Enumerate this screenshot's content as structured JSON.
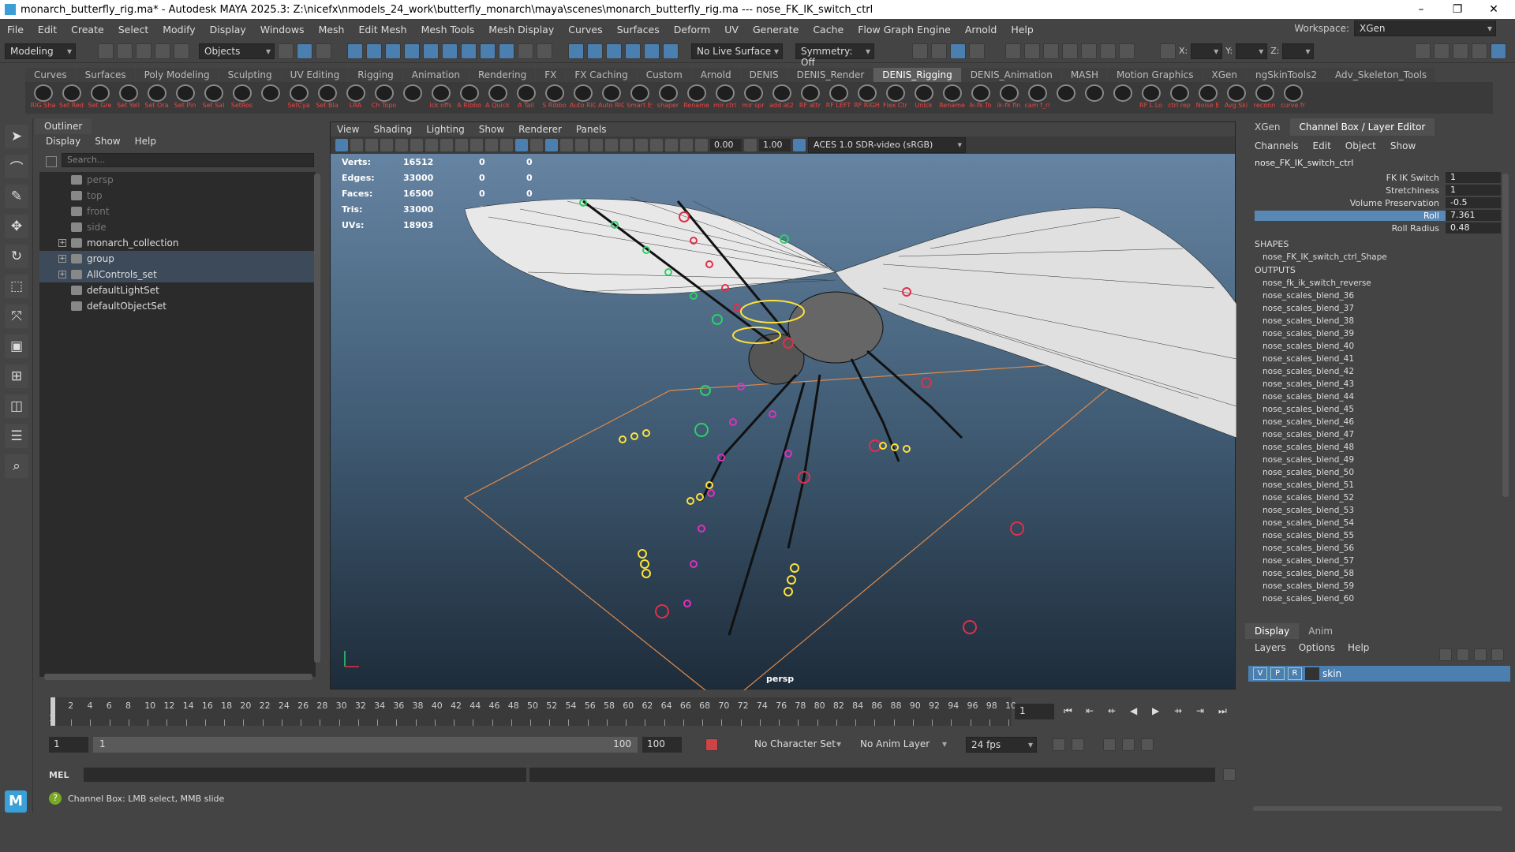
{
  "window": {
    "title": "monarch_butterfly_rig.ma* - Autodesk MAYA 2025.3: Z:\\nicefx\\nmodels_24_work\\butterfly_monarch\\maya\\scenes\\monarch_butterfly_rig.ma  ---  nose_FK_IK_switch_ctrl",
    "minimize": "–",
    "maximize": "❐",
    "close": "✕"
  },
  "menu": [
    "File",
    "Edit",
    "Create",
    "Select",
    "Modify",
    "Display",
    "Windows",
    "Mesh",
    "Edit Mesh",
    "Mesh Tools",
    "Mesh Display",
    "Curves",
    "Surfaces",
    "Deform",
    "UV",
    "Generate",
    "Cache",
    "Flow Graph Engine",
    "Arnold",
    "Help"
  ],
  "workspace": {
    "label": "Workspace:",
    "value": "XGen"
  },
  "statusline": {
    "menuset": "Modeling",
    "objects": "Objects",
    "live_surface": "No Live Surface",
    "symmetry": "Symmetry: Off",
    "x_label": "X:",
    "y_label": "Y:",
    "z_label": "Z:"
  },
  "shelf_tabs": [
    "Curves",
    "Surfaces",
    "Poly Modeling",
    "Sculpting",
    "UV Editing",
    "Rigging",
    "Animation",
    "Rendering",
    "FX",
    "FX Caching",
    "Custom",
    "Arnold",
    "DENIS",
    "DENIS_Render",
    "DENIS_Rigging",
    "DENIS_Animation",
    "MASH",
    "Motion Graphics",
    "XGen",
    "ngSkinTools2",
    "Adv_Skeleton_Tools"
  ],
  "shelf_active": "DENIS_Rigging",
  "shelf_items": [
    "RIG Sha",
    "Set Red",
    "Set Gre",
    "Set Yell",
    "Set Ora",
    "Set Pin",
    "Set Sal",
    "SetRos",
    "",
    "SetCya",
    "Set Bla",
    "LRA",
    "Ch Topo",
    "",
    "lck offs",
    "A Ribbo",
    "A Quick",
    "A Tail",
    "S Ribbo",
    "Auto RIG",
    "Auto RIG",
    "Smart Eye RIG",
    "shaper",
    "Rename",
    "mir ctrl",
    "mir spr",
    "add at2",
    "RF attr",
    "RF LEFT",
    "RF RIGH",
    "Flex Ctr",
    "Unlck",
    "Rename",
    "ik-fk To",
    "ik-fk fin",
    "cam f_ri",
    "",
    "",
    "",
    "RF L Lo",
    "ctrl rep",
    "Noise E",
    "Avg Ski",
    "reconn",
    "curve fr"
  ],
  "outliner": {
    "title": "Outliner",
    "menu": [
      "Display",
      "Show",
      "Help"
    ],
    "search_placeholder": "Search...",
    "items": [
      {
        "label": "persp",
        "dim": true,
        "exp": false
      },
      {
        "label": "top",
        "dim": true,
        "exp": false
      },
      {
        "label": "front",
        "dim": true,
        "exp": false
      },
      {
        "label": "side",
        "dim": true,
        "exp": false
      },
      {
        "label": "monarch_collection",
        "dim": false,
        "exp": true
      },
      {
        "label": "group",
        "dim": false,
        "exp": true,
        "sel": true
      },
      {
        "label": "AllControls_set",
        "dim": false,
        "exp": true,
        "sel": true
      },
      {
        "label": "defaultLightSet",
        "dim": false,
        "exp": false
      },
      {
        "label": "defaultObjectSet",
        "dim": false,
        "exp": false
      }
    ]
  },
  "viewport": {
    "menu": [
      "View",
      "Shading",
      "Lighting",
      "Show",
      "Renderer",
      "Panels"
    ],
    "exposure": "0.00",
    "gamma": "1.00",
    "colorspace": "ACES 1.0 SDR-video (sRGB)",
    "camera": "persp",
    "hud": [
      {
        "label": "Verts:",
        "a": "16512",
        "b": "0",
        "c": "0"
      },
      {
        "label": "Edges:",
        "a": "33000",
        "b": "0",
        "c": "0"
      },
      {
        "label": "Faces:",
        "a": "16500",
        "b": "0",
        "c": "0"
      },
      {
        "label": "Tris:",
        "a": "33000",
        "b": "0",
        "c": "0"
      },
      {
        "label": "UVs:",
        "a": "18903",
        "b": "0",
        "c": "0"
      }
    ]
  },
  "channelbox": {
    "tabs": [
      "XGen",
      "Channel Box / Layer Editor"
    ],
    "menu": [
      "Channels",
      "Edit",
      "Object",
      "Show"
    ],
    "object": "nose_FK_IK_switch_ctrl",
    "attributes": [
      {
        "name": "FK IK Switch",
        "value": "1"
      },
      {
        "name": "Stretchiness",
        "value": "1"
      },
      {
        "name": "Volume Preservation",
        "value": "-0.5"
      },
      {
        "name": "Roll",
        "value": "7.361",
        "hl": true
      },
      {
        "name": "Roll Radius",
        "value": "0.48"
      }
    ],
    "shapes_header": "SHAPES",
    "shape": "nose_FK_IK_switch_ctrl_Shape",
    "outputs_header": "OUTPUTS",
    "outputs": [
      "nose_fk_ik_switch_reverse",
      "nose_scales_blend_36",
      "nose_scales_blend_37",
      "nose_scales_blend_38",
      "nose_scales_blend_39",
      "nose_scales_blend_40",
      "nose_scales_blend_41",
      "nose_scales_blend_42",
      "nose_scales_blend_43",
      "nose_scales_blend_44",
      "nose_scales_blend_45",
      "nose_scales_blend_46",
      "nose_scales_blend_47",
      "nose_scales_blend_48",
      "nose_scales_blend_49",
      "nose_scales_blend_50",
      "nose_scales_blend_51",
      "nose_scales_blend_52",
      "nose_scales_blend_53",
      "nose_scales_blend_54",
      "nose_scales_blend_55",
      "nose_scales_blend_56",
      "nose_scales_blend_57",
      "nose_scales_blend_58",
      "nose_scales_blend_59",
      "nose_scales_blend_60"
    ]
  },
  "layers": {
    "tabs": [
      "Display",
      "Anim"
    ],
    "menu": [
      "Layers",
      "Options",
      "Help"
    ],
    "layer": {
      "v": "V",
      "p": "P",
      "r": "R",
      "name": "skin"
    }
  },
  "timeline": {
    "ticks": [
      "1",
      "2",
      "4",
      "6",
      "8",
      "10",
      "12",
      "14",
      "16",
      "18",
      "20",
      "22",
      "24",
      "26",
      "28",
      "30",
      "32",
      "34",
      "36",
      "38",
      "40",
      "42",
      "44",
      "46",
      "48",
      "50",
      "52",
      "54",
      "56",
      "58",
      "60",
      "62",
      "64",
      "66",
      "68",
      "70",
      "72",
      "74",
      "76",
      "78",
      "80",
      "82",
      "84",
      "86",
      "88",
      "90",
      "92",
      "94",
      "96",
      "98",
      "10"
    ],
    "current_frame": "1"
  },
  "range": {
    "start": "1",
    "inner_start": "1",
    "inner_end": "100",
    "end": "100",
    "character": "No Character Set",
    "anim_layer": "No Anim Layer",
    "fps": "24 fps"
  },
  "mel": {
    "label": "MEL"
  },
  "help": {
    "text": "Channel Box: LMB select, MMB slide"
  },
  "logo": {
    "text": "M"
  }
}
